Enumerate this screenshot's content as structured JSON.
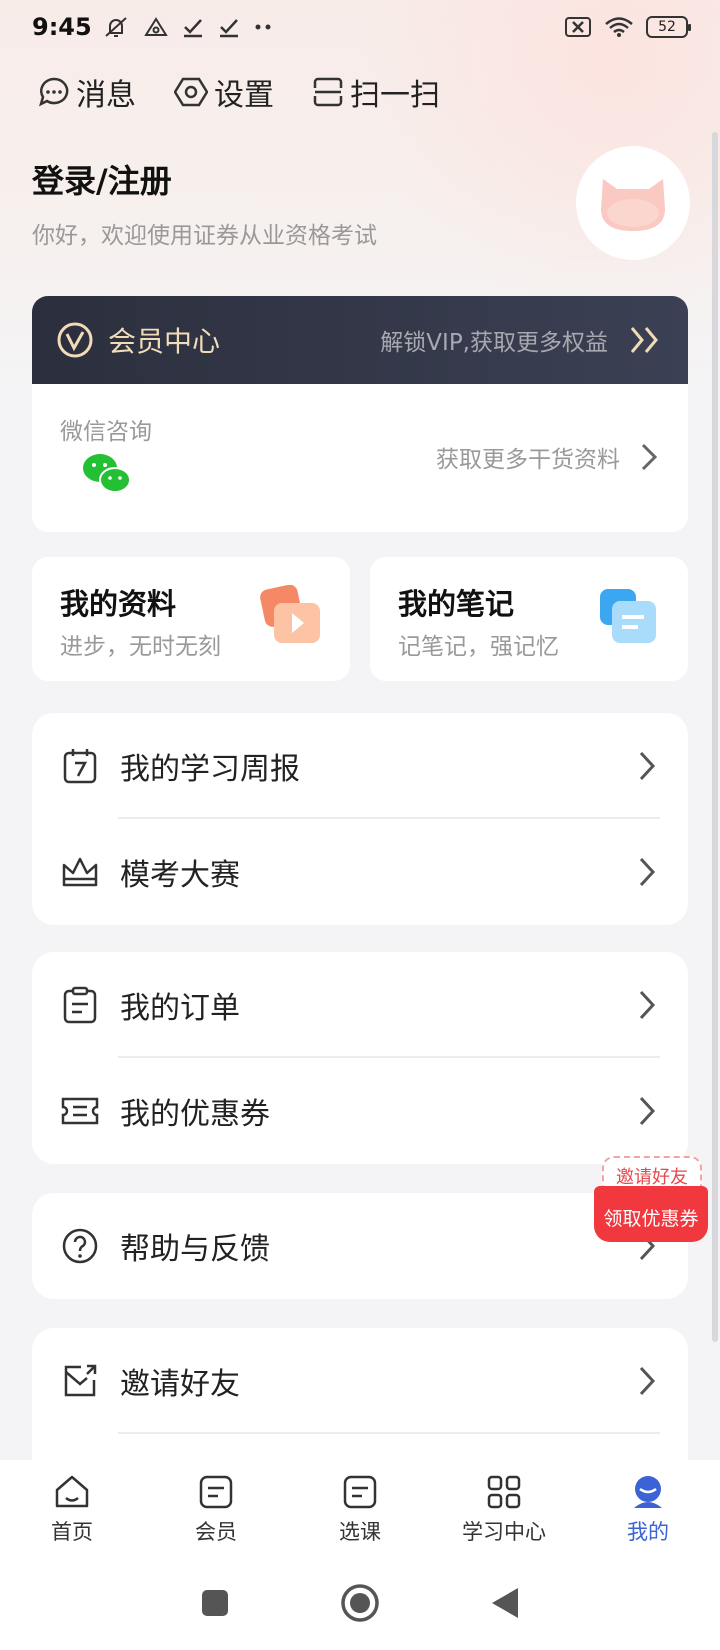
{
  "status_bar": {
    "time": "9:45",
    "battery": "52"
  },
  "top_nav": [
    {
      "label": "消息",
      "icon": "message-icon"
    },
    {
      "label": "设置",
      "icon": "settings-icon"
    },
    {
      "label": "扫一扫",
      "icon": "scan-icon"
    }
  ],
  "profile": {
    "title": "登录/注册",
    "subtitle": "你好，欢迎使用证券从业资格考试"
  },
  "vip": {
    "title": "会员中心",
    "desc": "解锁VIP,获取更多权益"
  },
  "wechat": {
    "label": "微信咨询",
    "action": "获取更多干货资料"
  },
  "cards": [
    {
      "title": "我的资料",
      "subtitle": "进步，无时无刻"
    },
    {
      "title": "我的笔记",
      "subtitle": "记笔记，强记忆"
    }
  ],
  "menu": {
    "weekly_report": "我的学习周报",
    "mock_exam": "模考大赛",
    "orders": "我的订单",
    "coupons": "我的优惠券",
    "help": "帮助与反馈",
    "invite": "邀请好友"
  },
  "float_badge": {
    "top": "邀请好友",
    "bottom": "领取优惠券"
  },
  "tabbar": [
    {
      "label": "首页"
    },
    {
      "label": "会员"
    },
    {
      "label": "选课"
    },
    {
      "label": "学习中心"
    },
    {
      "label": "我的"
    }
  ],
  "colors": {
    "accent": "#3b63d6",
    "vip_gold": "#f2dcb8",
    "badge_red": "#f0383e",
    "wechat_green": "#22c032"
  }
}
